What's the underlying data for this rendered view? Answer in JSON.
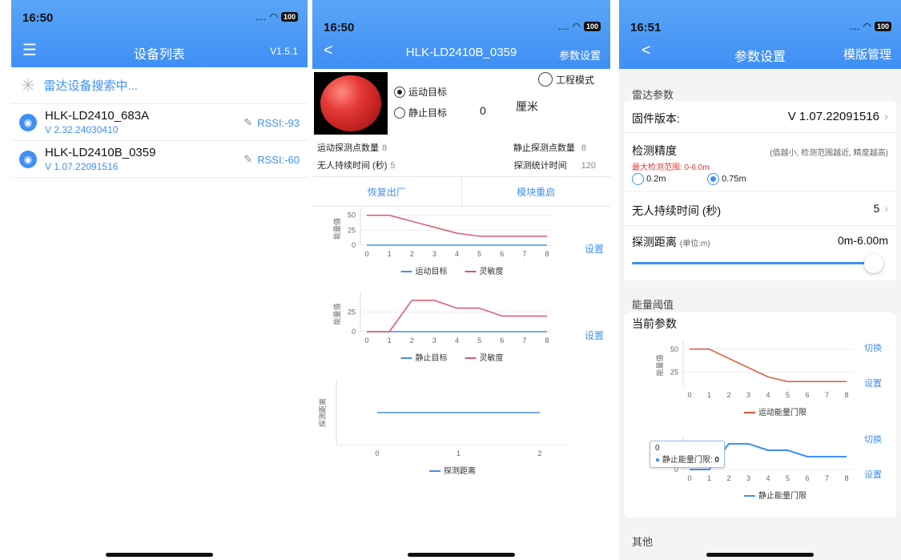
{
  "colors": {
    "accent": "#3f8ff5",
    "red": "#d9596b",
    "blue": "#4a8fdc",
    "p3_red": "#e0553d",
    "p3_blue": "#3f8ff5"
  },
  "screen1": {
    "time": "16:50",
    "signal": "....",
    "battery": "100",
    "title": "设备列表",
    "menu_icon": "menu-icon",
    "version": "V1.5.1",
    "search_text": "雷达设备搜索中...",
    "devices": [
      {
        "name": "HLK-LD2410_683A",
        "version": "V 2.32.24030410",
        "rssi": "RSSI:-93"
      },
      {
        "name": "HLK-LD2410B_0359",
        "version": "V 1.07.22091516",
        "rssi": "RSSI:-60"
      }
    ]
  },
  "screen2": {
    "time": "16:50",
    "signal": "....",
    "battery": "100",
    "back": "<",
    "title": "HLK-LD2410B_0359",
    "right": "参数设置",
    "engineering_mode": "工程模式",
    "moving_target": "运动目标",
    "static_target": "静止目标",
    "distance_value": "0",
    "distance_unit": "厘米",
    "moving_points_label": "运动探测点数量",
    "moving_points_value": "8",
    "static_points_label": "静止探测点数量",
    "static_points_value": "8",
    "no_one_label": "无人持续时间 (秒)",
    "no_one_value": "5",
    "stat_time_label": "探测统计时间",
    "stat_time_value": "120",
    "factory_reset": "恢复出厂",
    "restart": "模块重启",
    "set1": "设置",
    "set2": "设置"
  },
  "screen3": {
    "time": "16:51",
    "signal": "....",
    "battery": "100",
    "back": "<",
    "title": "参数设置",
    "right": "模版管理",
    "radar_params": "雷达参数",
    "firmware_label": "固件版本:",
    "firmware_value": "V 1.07.22091516",
    "precision_label": "检测精度",
    "precision_note": "(值越小, 检测范围越近, 精度越高)",
    "max_range": "最大检测范围: 0-6.0m",
    "opt1": "0.2m",
    "opt2": "0.75m",
    "no_one_label": "无人持续时间 (秒)",
    "no_one_value": "5",
    "distance_label": "探测距离",
    "distance_unit": "(单位:m)",
    "distance_value": "0m-6.00m",
    "slider_fraction": 1.0,
    "energy_threshold": "能量阈值",
    "current_params": "当前参数",
    "switch1": "切换",
    "set1": "设置",
    "switch2": "切换",
    "set2": "设置",
    "tooltip_value": "0",
    "tooltip_label": "静止能量门限: ",
    "tooltip_num": "0",
    "other": "其他"
  },
  "chart_data": [
    {
      "type": "line",
      "id": "s2_moving",
      "x": [
        0,
        1,
        2,
        3,
        4,
        5,
        6,
        7,
        8
      ],
      "ylabel": "能量值",
      "yticks": [
        0,
        25,
        50
      ],
      "ylim": [
        0,
        55
      ],
      "series": [
        {
          "name": "运动目标",
          "values": [
            0,
            0,
            0,
            0,
            0,
            0,
            0,
            0,
            0
          ]
        },
        {
          "name": "灵敏度",
          "values": [
            50,
            50,
            40,
            30,
            20,
            15,
            15,
            15,
            15
          ]
        }
      ]
    },
    {
      "type": "line",
      "id": "s2_static",
      "x": [
        0,
        1,
        2,
        3,
        4,
        5,
        6,
        7,
        8
      ],
      "ylabel": "能量值",
      "yticks": [
        0,
        25
      ],
      "ylim": [
        0,
        45
      ],
      "series": [
        {
          "name": "静止目标",
          "values": [
            0,
            0,
            0,
            0,
            0,
            0,
            0,
            0,
            0
          ]
        },
        {
          "name": "灵敏度",
          "values": [
            0,
            0,
            40,
            40,
            30,
            30,
            20,
            20,
            20
          ]
        }
      ]
    },
    {
      "type": "line",
      "id": "s2_distance",
      "x": [
        0,
        1,
        2
      ],
      "ylabel": "探测距离",
      "series": [
        {
          "name": "探测距离",
          "values": [
            0,
            0,
            0
          ]
        }
      ]
    },
    {
      "type": "line",
      "id": "s3_moving",
      "x": [
        0,
        1,
        2,
        3,
        4,
        5,
        6,
        7,
        8
      ],
      "ylabel": "能量值",
      "yticks": [
        25,
        50
      ],
      "ylim": [
        10,
        55
      ],
      "series": [
        {
          "name": "运动能量门限",
          "values": [
            50,
            50,
            40,
            30,
            20,
            15,
            15,
            15,
            15
          ]
        }
      ]
    },
    {
      "type": "line",
      "id": "s3_static",
      "x": [
        0,
        1,
        2,
        3,
        4,
        5,
        6,
        7,
        8
      ],
      "ylabel": "能量值",
      "yticks": [
        0
      ],
      "ylim": [
        0,
        45
      ],
      "series": [
        {
          "name": "静止能量门限",
          "values": [
            0,
            0,
            40,
            40,
            30,
            30,
            20,
            20,
            20
          ]
        }
      ]
    }
  ]
}
